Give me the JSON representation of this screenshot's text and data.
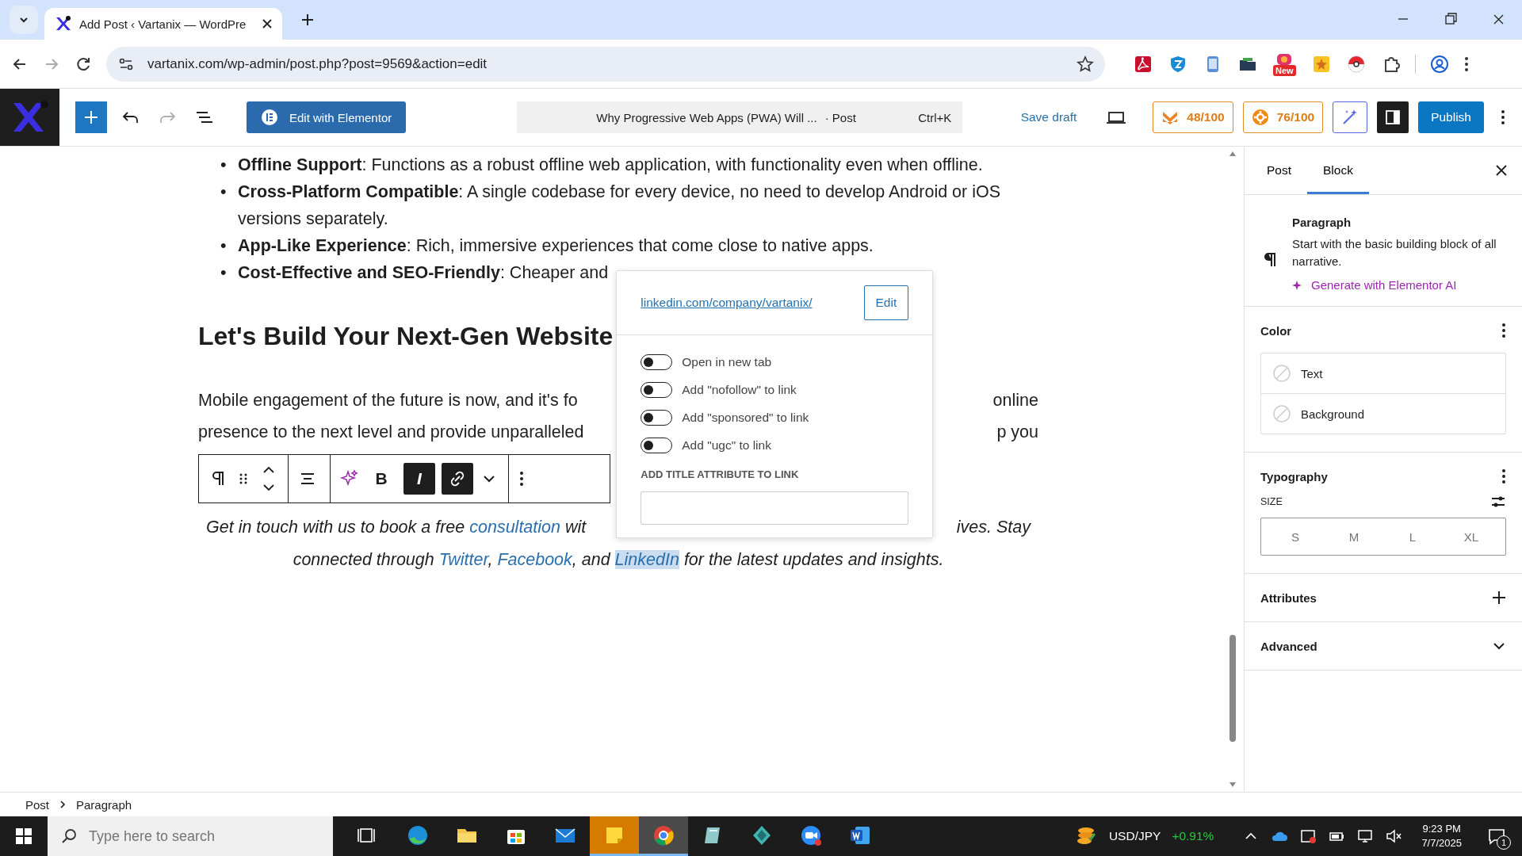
{
  "browser": {
    "tabs": [
      {
        "title": "Add Post ‹ Vartanix — WordPre",
        "selected": true
      }
    ],
    "url": "vartanix.com/wp-admin/post.php?post=9569&action=edit",
    "extensions": [
      {
        "kind": "pdf"
      },
      {
        "kind": "shield"
      },
      {
        "kind": "phone"
      },
      {
        "kind": "folder"
      },
      {
        "kind": "camera",
        "badge": "New"
      },
      {
        "kind": "star"
      },
      {
        "kind": "ball"
      },
      {
        "kind": "puzzle"
      }
    ]
  },
  "editor_header": {
    "redo": {
      "disabled": true
    },
    "elementor_button": "Edit with Elementor",
    "command": {
      "title": "Why Progressive Web Apps (PWA) Will ...",
      "type": "· Post",
      "shortcut": "Ctrl+K"
    },
    "save_draft": "Save draft",
    "scores": [
      {
        "kind": "m",
        "text": "48/100"
      },
      {
        "kind": "gear",
        "text": "76/100"
      }
    ],
    "sidebar_toggle": {
      "on": true
    },
    "publish": "Publish"
  },
  "content": {
    "bullets": [
      {
        "marker": "•",
        "text": "**Offline Support**: Functions as a robust offline web application, with functionality even when offline."
      },
      {
        "marker": "•",
        "text": "**Cross-Platform Compatible**: A single codebase for every device, no need to develop Android or iOS versions separately."
      },
      {
        "marker": "•",
        "text": "**App-Like Experience**: Rich, immersive experiences that come close to native apps."
      },
      {
        "marker": "•",
        "text": "**Cost-Effective and SEO-Friendly**: Cheaper and"
      }
    ],
    "heading": "Let's Build Your Next-Gen Website",
    "paragraph_lines": [
      {
        "left": "Mobile engagement of the future is now, and it's fo",
        "right": "online"
      },
      {
        "left": "presence to the next level and provide unparalleled",
        "right": "p you"
      }
    ],
    "block_toolbar": {
      "formats": [
        {
          "label": "B",
          "on": false
        },
        {
          "label": "I",
          "on": true
        }
      ],
      "link": {
        "on": true
      }
    },
    "italic_lines": [
      {
        "left": [
          {
            "kind": "text",
            "text": "Get in touch with us to book a free "
          },
          {
            "kind": "link",
            "text": "consultation",
            "selected": false
          },
          {
            "kind": "text",
            "text": " wit"
          }
        ],
        "right": "ives. Stay"
      },
      {
        "left": [
          {
            "kind": "text",
            "text": "connected through "
          },
          {
            "kind": "link",
            "text": "Twitter",
            "selected": false
          },
          {
            "kind": "text",
            "text": ", "
          },
          {
            "kind": "link",
            "text": "Facebook",
            "selected": false
          },
          {
            "kind": "text",
            "text": ", and "
          },
          {
            "kind": "link",
            "text": "LinkedIn",
            "selected": true
          },
          {
            "kind": "text",
            "text": " for the latest updates and insights."
          }
        ]
      }
    ]
  },
  "link_popover": {
    "url": "linkedin.com/company/vartanix/",
    "edit": "Edit",
    "toggles": [
      {
        "label": "Open in new tab",
        "on": false
      },
      {
        "label": "Add \"nofollow\" to link",
        "on": false
      },
      {
        "label": "Add \"sponsored\" to link",
        "on": false
      },
      {
        "label": "Add \"ugc\" to link",
        "on": false
      }
    ],
    "title_label": "ADD TITLE ATTRIBUTE TO LINK"
  },
  "sidebar": {
    "tabs": [
      {
        "label": "Post",
        "selected": false
      },
      {
        "label": "Block",
        "selected": true
      }
    ],
    "block": {
      "name": "Paragraph",
      "description": "Start with the basic building block of all narrative.",
      "ai": "Generate with Elementor AI"
    },
    "color": {
      "title": "Color",
      "items": [
        "Text",
        "Background"
      ]
    },
    "typography": {
      "title": "Typography",
      "size_label": "SIZE",
      "sizes": [
        {
          "label": "S",
          "selected": false
        },
        {
          "label": "M",
          "selected": false
        },
        {
          "label": "L",
          "selected": false
        },
        {
          "label": "XL",
          "selected": false
        }
      ]
    },
    "attributes": {
      "title": "Attributes"
    },
    "advanced": {
      "title": "Advanced",
      "expanded": false
    }
  },
  "breadcrumb": [
    "Post",
    "Paragraph"
  ],
  "taskbar": {
    "search_placeholder": "Type here to search",
    "apps": [
      {
        "kind": "taskview",
        "active": false
      },
      {
        "kind": "edge",
        "active": false
      },
      {
        "kind": "explorer",
        "active": false
      },
      {
        "kind": "store",
        "active": false
      },
      {
        "kind": "mail",
        "active": false
      },
      {
        "kind": "sticky",
        "active": true
      },
      {
        "kind": "chrome",
        "active": true
      },
      {
        "kind": "notes",
        "active": false
      },
      {
        "kind": "gem",
        "active": false
      },
      {
        "kind": "zoom",
        "active": false
      },
      {
        "kind": "word",
        "active": false
      }
    ],
    "ticker": {
      "symbol": "USD/JPY",
      "change": "+0.91%"
    },
    "time": "9:23 PM",
    "date": "7/7/2025",
    "notifications": "1"
  }
}
